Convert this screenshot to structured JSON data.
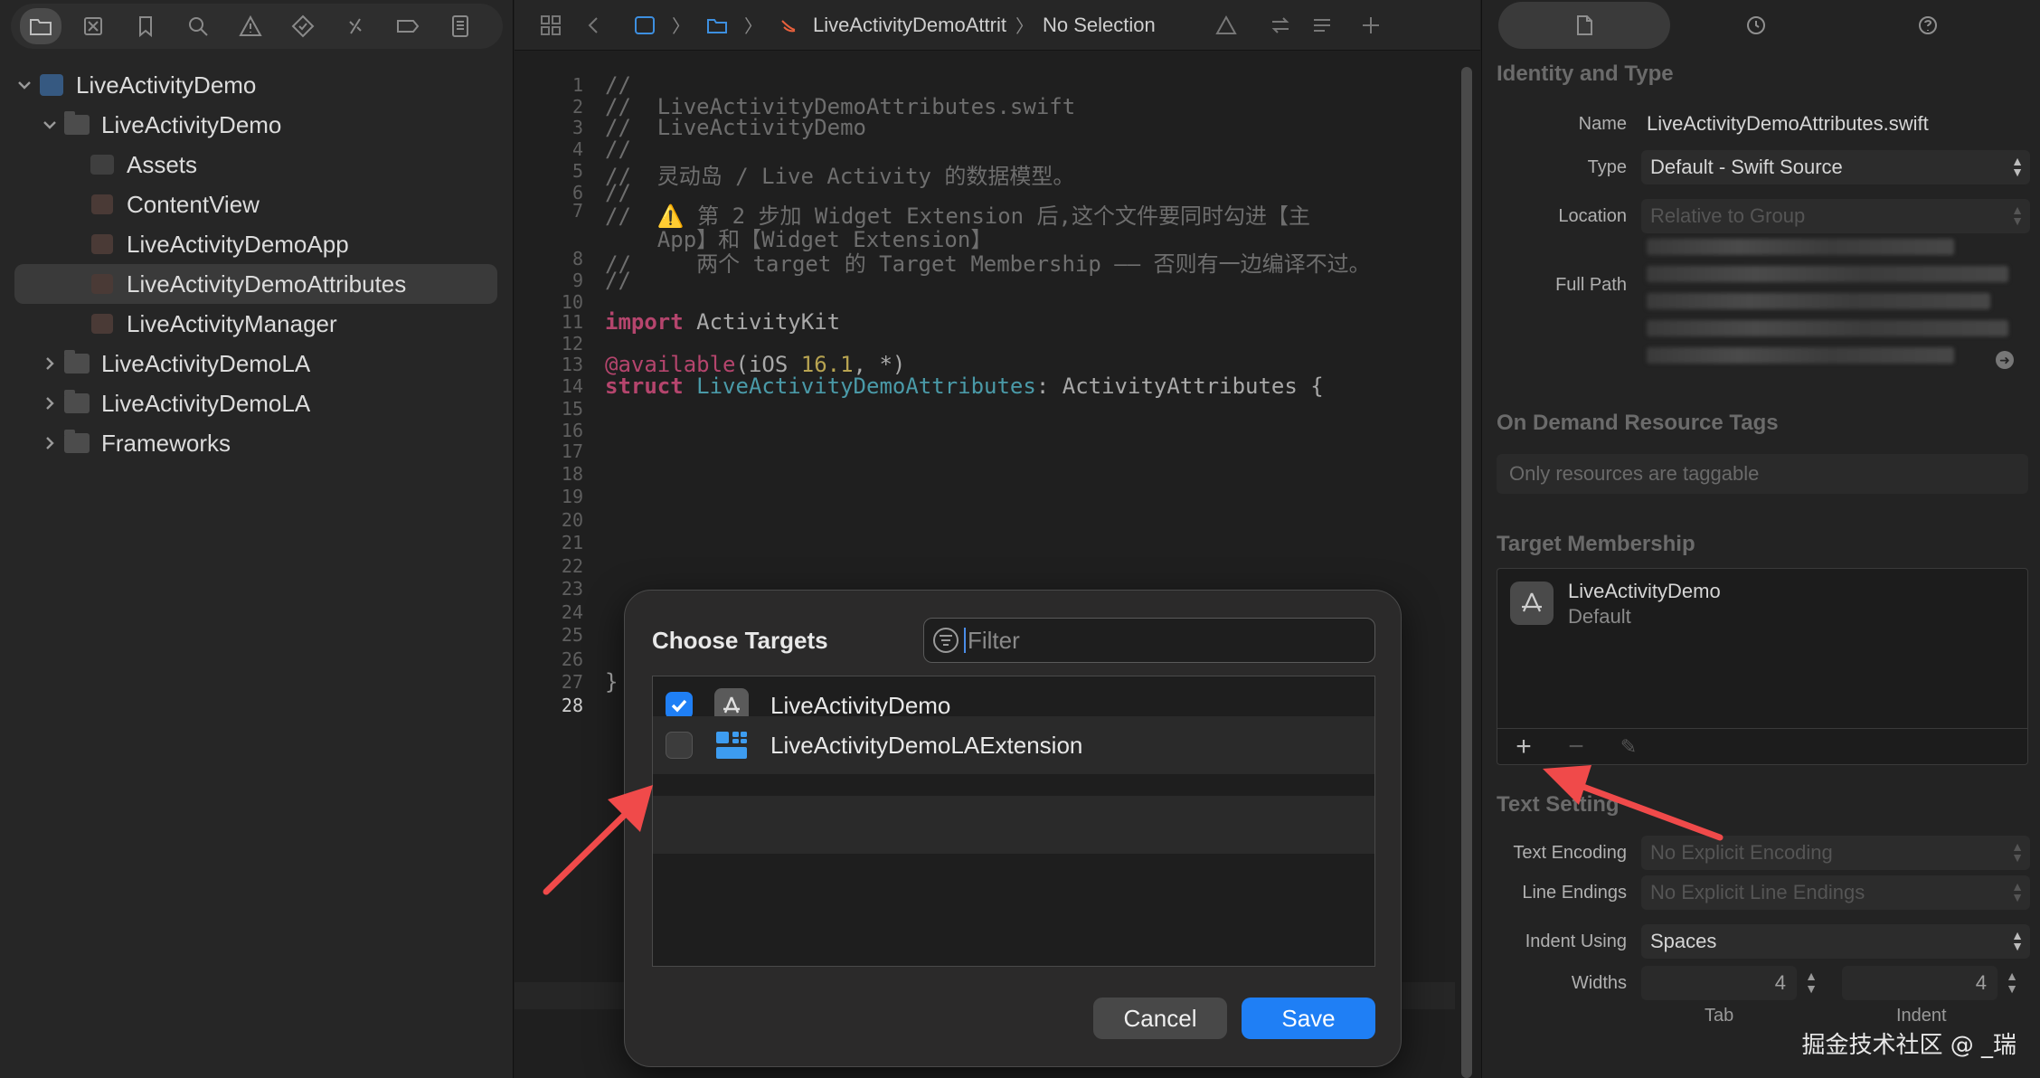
{
  "navigator": {
    "toolbar_icons": [
      "folder-icon",
      "source-control-icon",
      "bookmark-icon",
      "search-icon",
      "warning-icon",
      "test-icon",
      "debug-icon",
      "breakpoint-icon",
      "report-icon"
    ],
    "tree": [
      {
        "label": "LiveActivityDemo",
        "kind": "project",
        "indent": 0,
        "expanded": true
      },
      {
        "label": "LiveActivityDemo",
        "kind": "folder",
        "indent": 1,
        "expanded": true
      },
      {
        "label": "Assets",
        "kind": "assets",
        "indent": 2
      },
      {
        "label": "ContentView",
        "kind": "swift",
        "indent": 2
      },
      {
        "label": "LiveActivityDemoApp",
        "kind": "swift",
        "indent": 2
      },
      {
        "label": "LiveActivityDemoAttributes",
        "kind": "swift",
        "indent": 2,
        "selected": true
      },
      {
        "label": "LiveActivityManager",
        "kind": "swift",
        "indent": 2
      },
      {
        "label": "LiveActivityDemoLA",
        "kind": "folder",
        "indent": 1,
        "expanded": false
      },
      {
        "label": "LiveActivityDemoLA",
        "kind": "folder",
        "indent": 1,
        "expanded": false
      },
      {
        "label": "Frameworks",
        "kind": "folder",
        "indent": 1,
        "expanded": false
      }
    ]
  },
  "jumpbar": {
    "file_crumb": "LiveActivityDemoAttrit",
    "selection_crumb": "No Selection"
  },
  "code": {
    "lines": [
      {
        "n": "1",
        "text": "//"
      },
      {
        "n": "2",
        "text": "//  LiveActivityDemoAttributes.swift"
      },
      {
        "n": "3",
        "text": "//  LiveActivityDemo"
      },
      {
        "n": "4",
        "text": "//"
      },
      {
        "n": "5",
        "text": "//  灵动岛 / Live Activity 的数据模型。"
      },
      {
        "n": "6",
        "text": "//"
      },
      {
        "n": "7",
        "text": "//  ⚠️ 第 2 步加 Widget Extension 后,这个文件要同时勾进【主"
      },
      {
        "n": "",
        "text": "    App】和【Widget Extension】"
      },
      {
        "n": "8",
        "text": "//     两个 target 的 Target Membership —— 否则有一边编译不过。"
      },
      {
        "n": "9",
        "text": "//"
      },
      {
        "n": "10",
        "text": ""
      },
      {
        "n": "11",
        "kw": "import",
        "rest": " ActivityKit"
      },
      {
        "n": "12",
        "text": ""
      },
      {
        "n": "13",
        "attr": "@available",
        "rest_a": "(iOS ",
        "num": "16.1",
        "rest_b": ", *)"
      },
      {
        "n": "14",
        "kw": "struct",
        "type": " LiveActivityDemoAttributes",
        "rest": ": ActivityAttributes {"
      },
      {
        "n": "15",
        "text": ""
      },
      {
        "n": "16",
        "text": ""
      },
      {
        "n": "17",
        "text": ""
      },
      {
        "n": "18",
        "text": ""
      },
      {
        "n": "19",
        "text": ""
      },
      {
        "n": "20",
        "text": ""
      },
      {
        "n": "21",
        "text": ""
      },
      {
        "n": "22",
        "text": ""
      },
      {
        "n": "23",
        "text": ""
      },
      {
        "n": "24",
        "text": ""
      },
      {
        "n": "25",
        "text": ""
      },
      {
        "n": "26",
        "text": ""
      },
      {
        "n": "27",
        "text": "}"
      },
      {
        "n": "28",
        "text": ""
      }
    ]
  },
  "inspector": {
    "identity_title": "Identity and Type",
    "name_label": "Name",
    "name_value": "LiveActivityDemoAttributes.swift",
    "type_label": "Type",
    "type_value": "Default - Swift Source",
    "location_label": "Location",
    "location_value": "Relative to Group",
    "fullpath_label": "Full Path",
    "odr_title": "On Demand Resource Tags",
    "odr_placeholder": "Only resources are taggable",
    "membership_title": "Target Membership",
    "membership_target": "LiveActivityDemo",
    "membership_sub": "Default",
    "text_settings_title": "Text Setting",
    "encoding_label": "Text Encoding",
    "encoding_value": "No Explicit Encoding",
    "endings_label": "Line Endings",
    "endings_value": "No Explicit Line Endings",
    "indent_label": "Indent Using",
    "indent_value": "Spaces",
    "widths_label": "Widths",
    "tab_value": "4",
    "indent_width_value": "4",
    "tab_sublabel": "Tab",
    "indent_sublabel": "Indent"
  },
  "modal": {
    "title": "Choose Targets",
    "filter_placeholder": "Filter",
    "targets": [
      {
        "name": "LiveActivityDemo",
        "checked": true,
        "icon": "app-target-icon"
      },
      {
        "name": "LiveActivityDemoLAExtension",
        "checked": false,
        "icon": "widget-extension-icon"
      }
    ],
    "cancel_label": "Cancel",
    "save_label": "Save"
  },
  "colors": {
    "accent": "#1f7ff5",
    "annotation_arrow": "#f04a4a"
  },
  "watermark": "掘金技术社区 @ _瑞"
}
